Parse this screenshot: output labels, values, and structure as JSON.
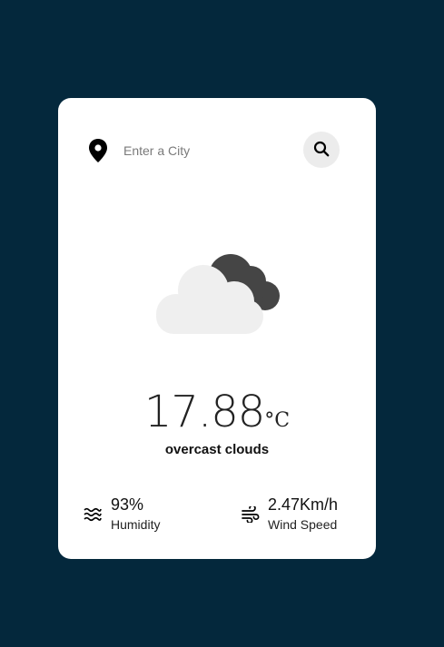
{
  "search": {
    "placeholder": "Enter a City",
    "icon": "location-pin-icon",
    "button_icon": "search-icon"
  },
  "weather": {
    "icon": "overcast-clouds-icon",
    "temperature": "17.88",
    "unit": "°C",
    "description": "overcast clouds"
  },
  "details": {
    "humidity": {
      "value": "93%",
      "label": "Humidity",
      "icon": "humidity-waves-icon"
    },
    "wind": {
      "value": "2.47Km/h",
      "label": "Wind Speed",
      "icon": "wind-icon"
    }
  },
  "colors": {
    "background": "#04283c",
    "card": "#ffffff",
    "cloud_light": "#efefef",
    "cloud_dark": "#454545"
  }
}
